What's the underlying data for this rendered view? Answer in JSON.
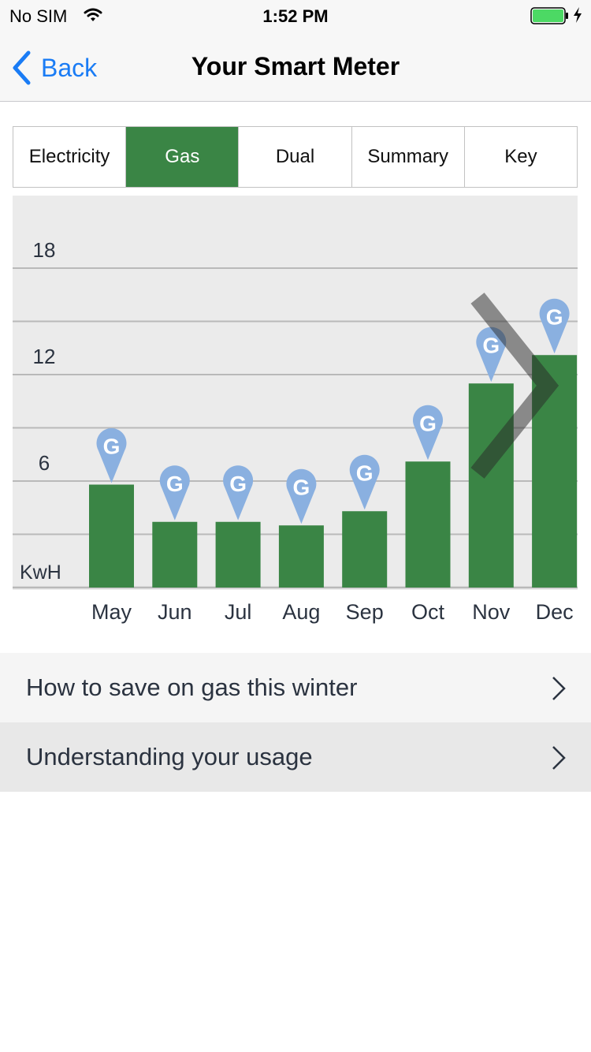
{
  "status_bar": {
    "carrier": "No SIM",
    "time": "1:52 PM",
    "battery_color": "#4cd964"
  },
  "nav": {
    "back_label": "Back",
    "title": "Your Smart Meter",
    "accent": "#1a7cf5"
  },
  "tabs": [
    {
      "label": "Electricity",
      "active": false
    },
    {
      "label": "Gas",
      "active": true
    },
    {
      "label": "Dual",
      "active": false
    },
    {
      "label": "Summary",
      "active": false
    },
    {
      "label": "Key",
      "active": false
    }
  ],
  "chart_data": {
    "type": "bar",
    "categories": [
      "May",
      "Jun",
      "Jul",
      "Aug",
      "Sep",
      "Oct",
      "Nov",
      "Dec"
    ],
    "values": [
      5.8,
      3.7,
      3.7,
      3.5,
      4.3,
      7.1,
      11.5,
      13.1
    ],
    "ylabel": "KwH",
    "y_ticks": [
      6,
      12,
      18
    ],
    "ylim": [
      0,
      21
    ],
    "marker_label": "G",
    "grid": true,
    "bar_color": "#3a8545",
    "marker_color": "#8ab0e0",
    "background": "#ebebeb"
  },
  "list": [
    {
      "label": "How to save on gas this winter"
    },
    {
      "label": "Understanding your usage"
    }
  ]
}
